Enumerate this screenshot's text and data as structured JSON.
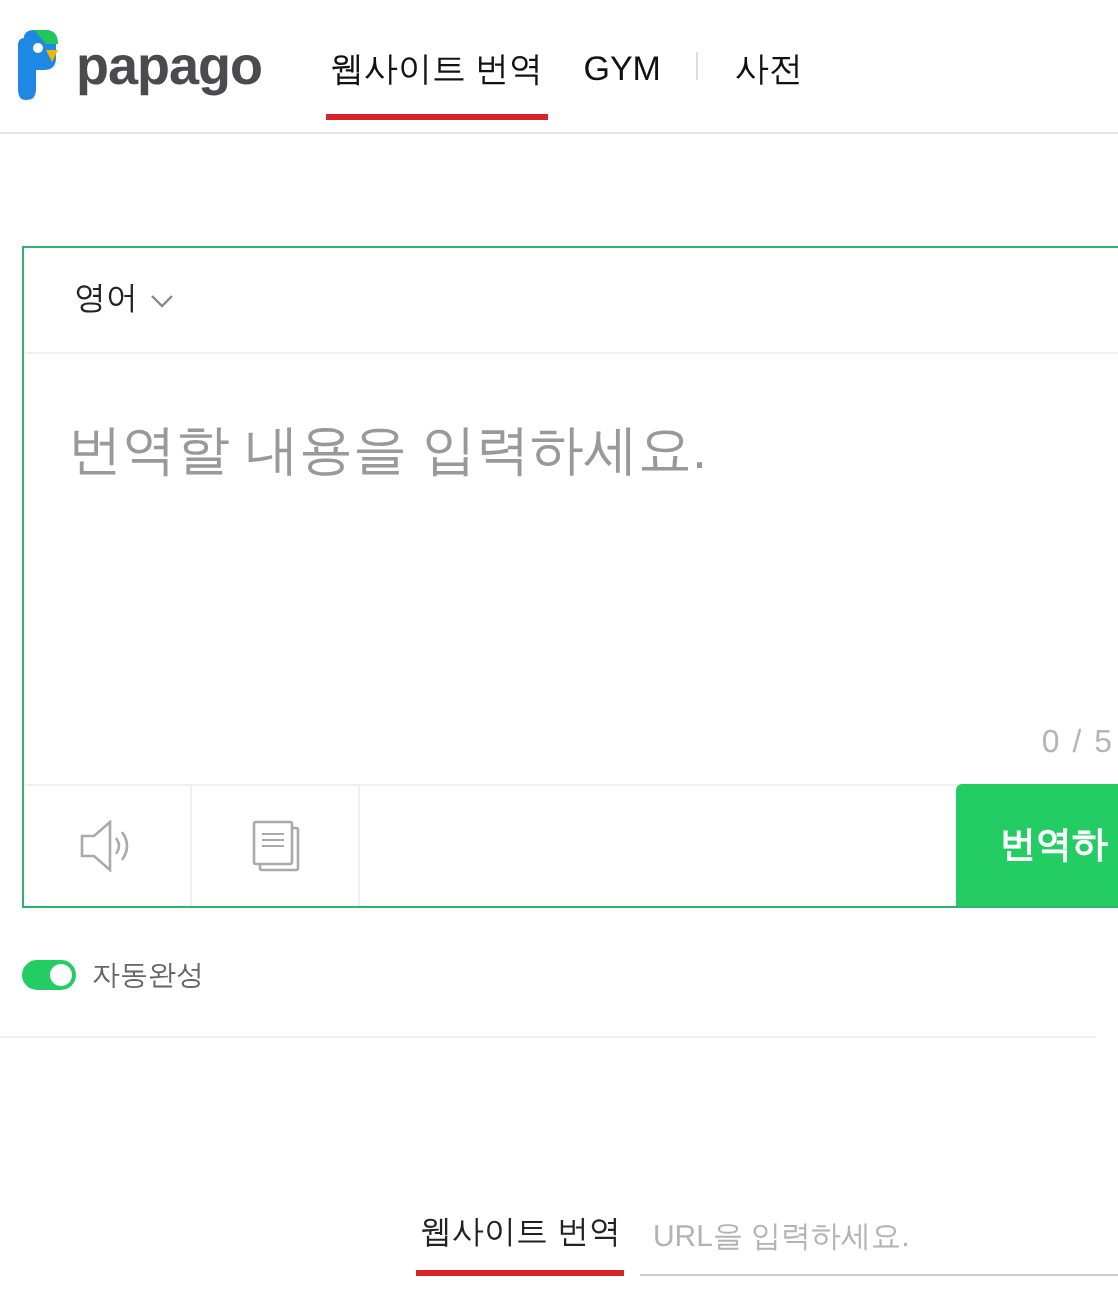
{
  "header": {
    "logo_text": "papago",
    "nav": [
      {
        "label": "웹사이트 번역",
        "selected": true
      },
      {
        "label": "GYM",
        "selected": false
      },
      {
        "label": "사전",
        "selected": false
      }
    ]
  },
  "translator": {
    "source_language": "영어",
    "placeholder": "번역할 내용을 입력하세요.",
    "counter": "0 / 5",
    "translate_button": "번역하"
  },
  "autocomplete": {
    "label": "자동완성",
    "on": true
  },
  "website_translate": {
    "label": "웹사이트 번역",
    "selected": true,
    "placeholder": "URL을 입력하세요."
  }
}
